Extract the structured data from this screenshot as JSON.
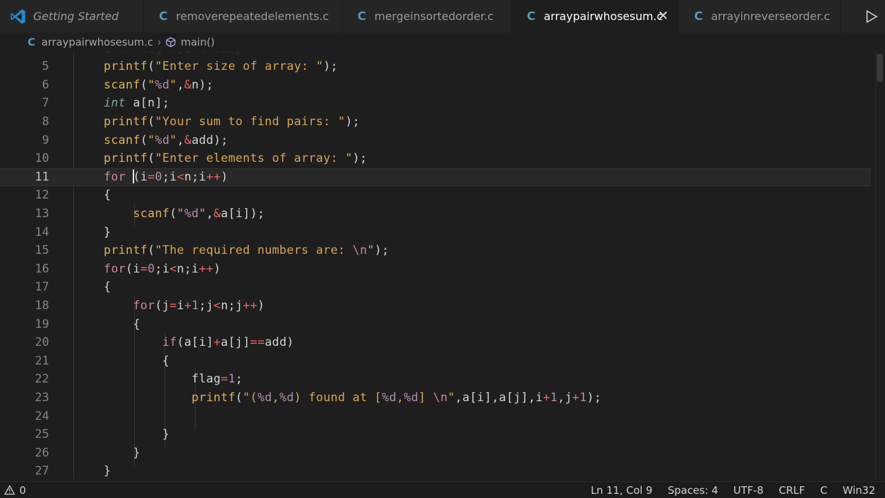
{
  "tabs": [
    {
      "label": "Getting Started",
      "icon": "vscode-icon",
      "active": false
    },
    {
      "label": "removerepeatedelements.c",
      "icon": "c-file-icon",
      "active": false
    },
    {
      "label": "mergeinsortedorder.c",
      "icon": "c-file-icon",
      "active": false
    },
    {
      "label": "arraypairwhosesum.c",
      "icon": "c-file-icon",
      "active": true
    },
    {
      "label": "arrayinreverseorder.c",
      "icon": "c-file-icon",
      "active": false
    }
  ],
  "breadcrumb": {
    "file": "arraypairwhosesum.c",
    "symbol": "main()"
  },
  "editor": {
    "line_numbers": [
      "5",
      "6",
      "7",
      "8",
      "9",
      "10",
      "11",
      "12",
      "13",
      "14",
      "15",
      "16",
      "17",
      "18",
      "19",
      "20",
      "21",
      "22",
      "23",
      "24",
      "25",
      "26",
      "27"
    ],
    "current_line": "11"
  },
  "status": {
    "problems": "0",
    "position": "Ln 11, Col 9",
    "spaces": "Spaces: 4",
    "encoding": "UTF-8",
    "eol": "CRLF",
    "language": "C",
    "platform": "Win32"
  },
  "colors": {
    "accent": "#519aba",
    "background": "#1e1e1e",
    "tabbar": "#252526"
  }
}
